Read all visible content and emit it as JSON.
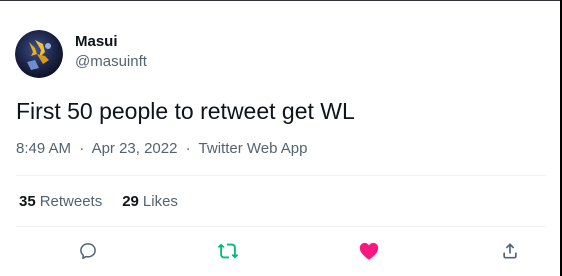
{
  "author": {
    "display_name": "Masui",
    "handle": "@masuinft",
    "avatar_icon": "avatar-image"
  },
  "tweet": {
    "text": "First 50 people to retweet get WL",
    "time": "8:49 AM",
    "date": "Apr 23, 2022",
    "source": "Twitter Web App",
    "separator": "·"
  },
  "stats": {
    "retweets_count": "35",
    "retweets_label": "Retweets",
    "likes_count": "29",
    "likes_label": "Likes"
  },
  "actions": {
    "reply_icon": "reply-icon",
    "retweet_icon": "retweet-icon",
    "like_icon": "heart-icon",
    "share_icon": "share-icon"
  },
  "colors": {
    "text_primary": "#0f1419",
    "text_secondary": "#536471",
    "retweet_green": "#00ba7c",
    "like_pink": "#f91880",
    "divider": "#eff3f4"
  }
}
